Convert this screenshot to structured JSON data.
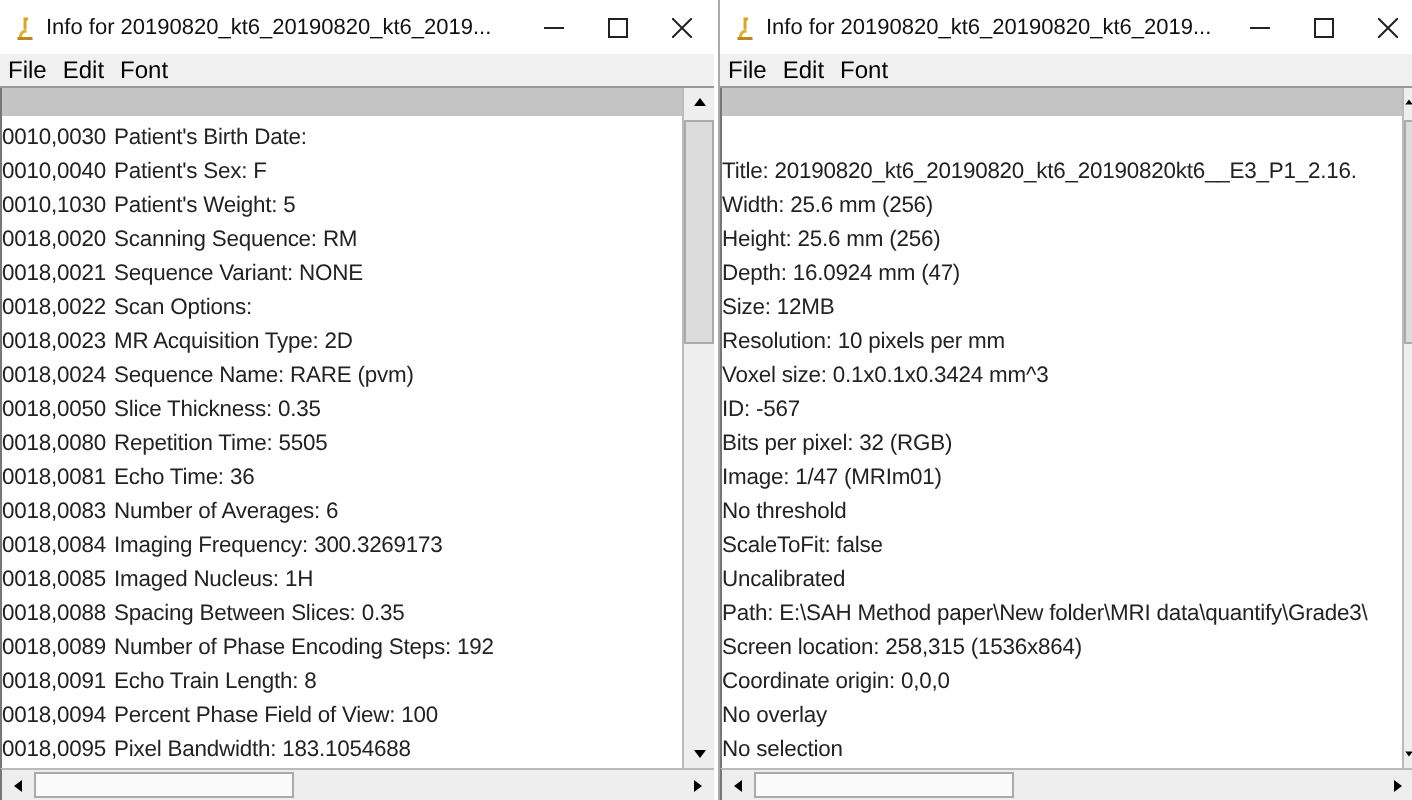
{
  "windows": [
    {
      "title": "Info for 20190820_kt6_20190820_kt6_2019...",
      "menu": [
        "File",
        "Edit",
        "Font"
      ],
      "lines": [
        {
          "tag": "0010,0030",
          "text": "Patient's Birth Date:"
        },
        {
          "tag": "0010,0040",
          "text": "Patient's Sex: F"
        },
        {
          "tag": "0010,1030",
          "text": "Patient's Weight: 5"
        },
        {
          "tag": "0018,0020",
          "text": "Scanning Sequence: RM"
        },
        {
          "tag": "0018,0021",
          "text": "Sequence Variant: NONE"
        },
        {
          "tag": "0018,0022",
          "text": "Scan Options:"
        },
        {
          "tag": "0018,0023",
          "text": "MR Acquisition Type: 2D"
        },
        {
          "tag": "0018,0024",
          "text": "Sequence Name: RARE (pvm)"
        },
        {
          "tag": "0018,0050",
          "text": "Slice Thickness: 0.35"
        },
        {
          "tag": "0018,0080",
          "text": "Repetition Time: 5505"
        },
        {
          "tag": "0018,0081",
          "text": "Echo Time: 36"
        },
        {
          "tag": "0018,0083",
          "text": "Number of Averages: 6"
        },
        {
          "tag": "0018,0084",
          "text": "Imaging Frequency: 300.3269173"
        },
        {
          "tag": "0018,0085",
          "text": "Imaged Nucleus: 1H"
        },
        {
          "tag": "0018,0088",
          "text": "Spacing Between Slices: 0.35"
        },
        {
          "tag": "0018,0089",
          "text": "Number of Phase Encoding Steps: 192"
        },
        {
          "tag": "0018,0091",
          "text": "Echo Train Length: 8"
        },
        {
          "tag": "0018,0094",
          "text": "Percent Phase Field of View: 100"
        },
        {
          "tag": "0018,0095",
          "text": "Pixel Bandwidth: 183.1054688"
        }
      ]
    },
    {
      "title": "Info for 20190820_kt6_20190820_kt6_2019...",
      "menu": [
        "File",
        "Edit",
        "Font"
      ],
      "lines": [
        {
          "text": "Title: 20190820_kt6_20190820_kt6_20190820kt6__E3_P1_2.16."
        },
        {
          "text": "Width:  25.6 mm (256)"
        },
        {
          "text": "Height:  25.6 mm (256)"
        },
        {
          "text": "Depth:  16.0924 mm (47)"
        },
        {
          "text": "Size:  12MB"
        },
        {
          "text": "Resolution:  10 pixels per mm"
        },
        {
          "text": "Voxel size: 0.1x0.1x0.3424 mm^3"
        },
        {
          "text": "ID: -567"
        },
        {
          "text": "Bits per pixel: 32 (RGB)"
        },
        {
          "text": "Image: 1/47 (MRIm01)"
        },
        {
          "text": "No threshold"
        },
        {
          "text": "ScaleToFit: false"
        },
        {
          "text": "Uncalibrated"
        },
        {
          "text": "Path: E:\\SAH Method paper\\New folder\\MRI data\\quantify\\Grade3\\"
        },
        {
          "text": "Screen location: 258,315 (1536x864)"
        },
        {
          "text": "Coordinate origin:  0,0,0"
        },
        {
          "text": "No overlay"
        },
        {
          "text": "No selection"
        }
      ]
    }
  ]
}
